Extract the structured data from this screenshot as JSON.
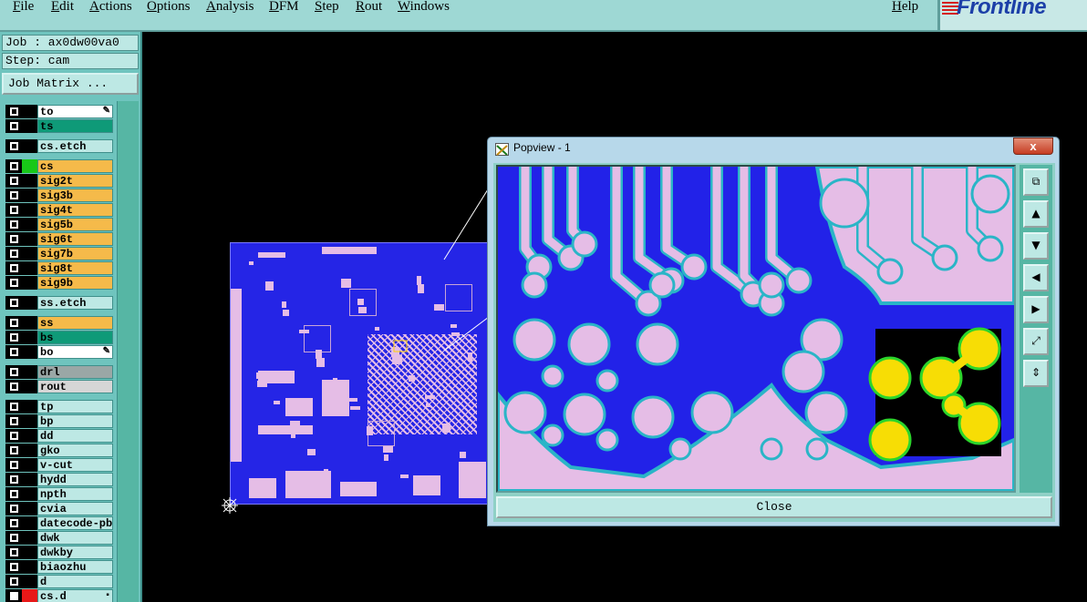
{
  "menubar": {
    "items": [
      "File",
      "Edit",
      "Actions",
      "Options",
      "Analysis",
      "DFM",
      "Step",
      "Rout",
      "Windows"
    ],
    "help": "Help"
  },
  "logo": {
    "brand": "Frontline"
  },
  "job": {
    "job_label": "Job : ax0dw00va0",
    "step_label": "Step: cam",
    "matrix_button": "Job Matrix ..."
  },
  "layers": [
    {
      "name": "to",
      "color": "#ffffff",
      "swatch": "#000000",
      "mark": "✎"
    },
    {
      "name": "ts",
      "color": "#0f9a78",
      "swatch": "#000000"
    },
    {
      "name": "cs.etch",
      "color": "#bde8e4",
      "swatch": "#000000"
    },
    {
      "name": "cs",
      "color": "#f5ba4a",
      "swatch": "#18c818"
    },
    {
      "name": "sig2t",
      "color": "#f5ba4a",
      "swatch": "#000000"
    },
    {
      "name": "sig3b",
      "color": "#f5ba4a",
      "swatch": "#000000"
    },
    {
      "name": "sig4t",
      "color": "#f5ba4a",
      "swatch": "#000000"
    },
    {
      "name": "sig5b",
      "color": "#f5ba4a",
      "swatch": "#000000"
    },
    {
      "name": "sig6t",
      "color": "#f5ba4a",
      "swatch": "#000000"
    },
    {
      "name": "sig7b",
      "color": "#f5ba4a",
      "swatch": "#000000"
    },
    {
      "name": "sig8t",
      "color": "#f5ba4a",
      "swatch": "#000000"
    },
    {
      "name": "sig9b",
      "color": "#f5ba4a",
      "swatch": "#000000"
    },
    {
      "name": "ss.etch",
      "color": "#bde8e4",
      "swatch": "#000000"
    },
    {
      "name": "ss",
      "color": "#f5ba4a",
      "swatch": "#000000"
    },
    {
      "name": "bs",
      "color": "#0f9a78",
      "swatch": "#000000"
    },
    {
      "name": "bo",
      "color": "#ffffff",
      "swatch": "#000000",
      "mark": "✎"
    },
    {
      "name": "drl",
      "color": "#9aa7a6",
      "swatch": "#000000"
    },
    {
      "name": "rout",
      "color": "#d6d6d6",
      "swatch": "#000000"
    },
    {
      "name": "tp",
      "color": "#bde8e4",
      "swatch": "#000000"
    },
    {
      "name": "bp",
      "color": "#bde8e4",
      "swatch": "#000000"
    },
    {
      "name": "dd",
      "color": "#bde8e4",
      "swatch": "#000000"
    },
    {
      "name": "gko",
      "color": "#bde8e4",
      "swatch": "#000000"
    },
    {
      "name": "v-cut",
      "color": "#bde8e4",
      "swatch": "#000000"
    },
    {
      "name": "hydd",
      "color": "#bde8e4",
      "swatch": "#000000"
    },
    {
      "name": "npth",
      "color": "#bde8e4",
      "swatch": "#000000"
    },
    {
      "name": "cvia",
      "color": "#bde8e4",
      "swatch": "#000000"
    },
    {
      "name": "datecode-pbe",
      "color": "#bde8e4",
      "swatch": "#000000"
    },
    {
      "name": "dwk",
      "color": "#bde8e4",
      "swatch": "#000000"
    },
    {
      "name": "dwkby",
      "color": "#bde8e4",
      "swatch": "#000000"
    },
    {
      "name": "biaozhu",
      "color": "#bde8e4",
      "swatch": "#000000"
    },
    {
      "name": "d",
      "color": "#bde8e4",
      "swatch": "#000000"
    },
    {
      "name": "cs.d",
      "color": "#bde8e4",
      "swatch": "#e81818",
      "mark": "▪",
      "on": true
    }
  ],
  "popview": {
    "title": "Popview - 1",
    "close_x": "x",
    "close_button": "Close",
    "tools": [
      "zoom-fit-icon",
      "pan-up-icon",
      "pan-down-icon",
      "pan-left-icon",
      "pan-right-icon",
      "zoom-in-icon",
      "zoom-out-icon"
    ],
    "tool_glyphs": [
      "⧉",
      "▲",
      "▼",
      "◀",
      "▶",
      "⤢",
      "⇕"
    ]
  },
  "colors": {
    "copper": "#2222e8",
    "pad": "#e5bde6",
    "clearance": "#2ab5c7",
    "highlight": "#f7dd05",
    "highlight_edge": "#2bd52b"
  }
}
